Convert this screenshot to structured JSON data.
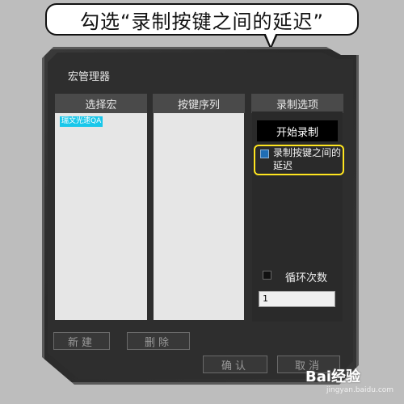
{
  "callout": {
    "text": "勾选“录制按键之间的延迟”"
  },
  "dialog": {
    "title": "宏管理器",
    "panels": {
      "select_macro": {
        "header": "选择宏",
        "items": [
          "瑞文光速QA"
        ]
      },
      "key_sequence": {
        "header": "按键序列"
      },
      "record_options": {
        "header": "录制选项"
      }
    },
    "start_record_label": "开始录制",
    "record_delay_label": "录制按键之间的延迟",
    "loop_count_label": "循环次数",
    "loop_count_value": "1",
    "new_label": "新建",
    "delete_label": "删除",
    "ok_label": "确认",
    "cancel_label": "取消"
  },
  "watermark": {
    "text": "Bai经验",
    "sub": "jingyan.baidu.com"
  },
  "colors": {
    "highlight": "#ffe51f",
    "selected_item": "#19c7ea"
  }
}
